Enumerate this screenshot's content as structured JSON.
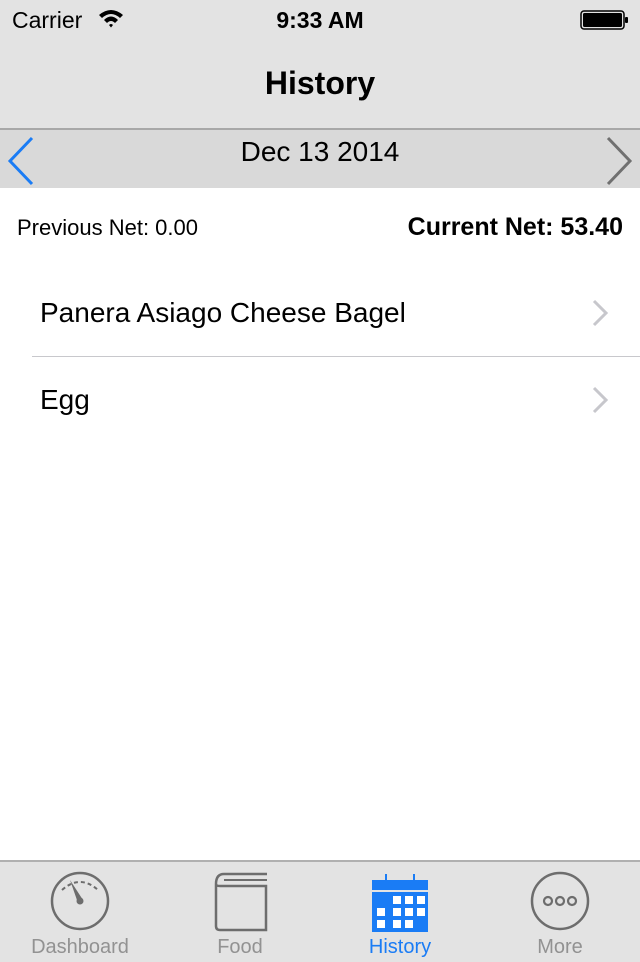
{
  "status_bar": {
    "carrier": "Carrier",
    "time": "9:33 AM",
    "wifi_icon": "wifi-icon",
    "battery_icon": "battery-full-icon"
  },
  "nav": {
    "title": "History"
  },
  "date_nav": {
    "date": "Dec 13 2014",
    "prev_icon": "chevron-left-icon",
    "next_icon": "chevron-right-icon"
  },
  "summary": {
    "previous_net": "Previous Net: 0.00",
    "current_net": "Current Net: 53.40"
  },
  "items": [
    {
      "label": "Panera Asiago Cheese Bagel"
    },
    {
      "label": "Egg"
    }
  ],
  "tabs": [
    {
      "label": "Dashboard",
      "icon": "gauge-icon",
      "active": false
    },
    {
      "label": "Food",
      "icon": "book-icon",
      "active": false
    },
    {
      "label": "History",
      "icon": "calendar-icon",
      "active": true
    },
    {
      "label": "More",
      "icon": "more-icon",
      "active": false
    }
  ],
  "colors": {
    "accent": "#1a7cf5",
    "inactive": "#929292",
    "bar_bg": "#e3e3e3"
  }
}
